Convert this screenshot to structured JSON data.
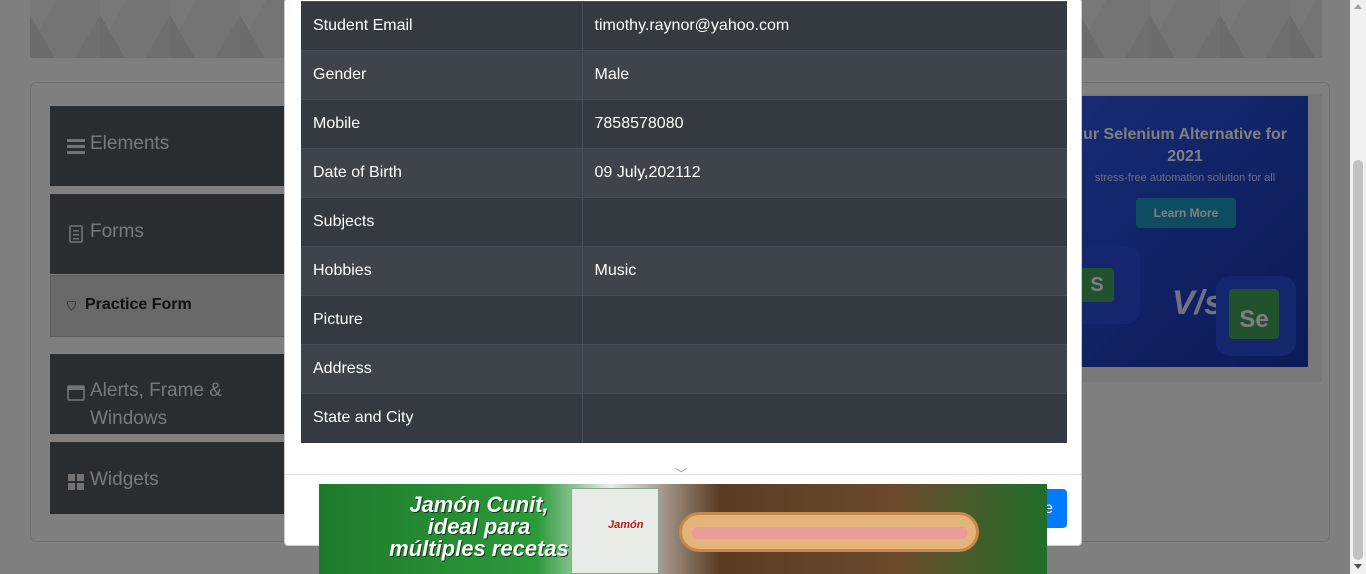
{
  "sidebar": {
    "groups": [
      {
        "label": "Elements",
        "icon": "hamburger-icon"
      },
      {
        "label": "Forms",
        "icon": "document-icon"
      },
      {
        "label": "Alerts, Frame & Windows",
        "icon": "window-icon"
      },
      {
        "label": "Widgets",
        "icon": "grid-icon"
      }
    ],
    "active_item": {
      "label": "Practice Form",
      "icon": "html5-icon"
    }
  },
  "right_ad": {
    "title": "ur Selenium Alternative for 2021",
    "subtitle": "stress-free automation solution for all",
    "button": "Learn More",
    "logo_left": "S",
    "vs": "V/s",
    "logo_right": "Se"
  },
  "modal": {
    "rows": [
      {
        "label": "Student Email",
        "value": "timothy.raynor@yahoo.com"
      },
      {
        "label": "Gender",
        "value": "Male"
      },
      {
        "label": "Mobile",
        "value": "7858578080"
      },
      {
        "label": "Date of Birth",
        "value": "09 July,202112"
      },
      {
        "label": "Subjects",
        "value": ""
      },
      {
        "label": "Hobbies",
        "value": "Music"
      },
      {
        "label": "Picture",
        "value": ""
      },
      {
        "label": "Address",
        "value": ""
      },
      {
        "label": "State and City",
        "value": ""
      }
    ],
    "close_label": "e"
  },
  "bottom_ad": {
    "headline": "Jamón Cunit, ideal para múltiples recetas",
    "pack_label": "Jamón"
  },
  "colors": {
    "table_dark": "#343a40",
    "table_alt": "#3e444a",
    "sidebar_header": "#535a61",
    "primary": "#007bff",
    "ad_blue": "#2f58e9"
  }
}
